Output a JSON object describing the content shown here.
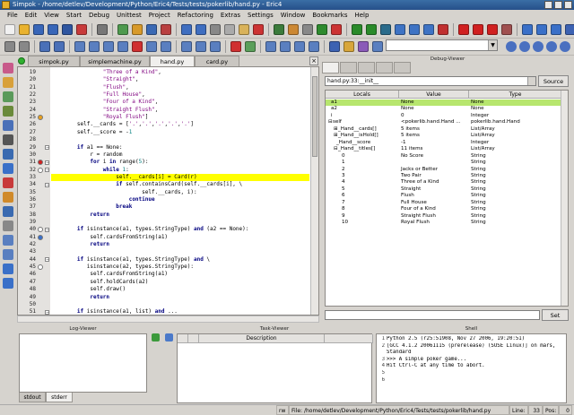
{
  "window": {
    "title": "Simpok - /home/detlev/Development/Python/Eric4/Tests/tests/pokerlib/hand.py - Eric4"
  },
  "menubar": [
    "File",
    "Edit",
    "View",
    "Start",
    "Debug",
    "Unittest",
    "Project",
    "Refactoring",
    "Extras",
    "Settings",
    "Window",
    "Bookmarks",
    "Help"
  ],
  "colors": {
    "current_line": "#ffff00",
    "selected_var": "#b7e66e",
    "keyword": "#00007f",
    "string": "#7f007f",
    "number": "#007f7f",
    "title_bar": "#3a6ea5"
  },
  "editor": {
    "tabs": [
      "simpok.py",
      "simplemachine.py",
      "hand.py",
      "card.py"
    ],
    "active_tab": 2,
    "lines": [
      {
        "n": "19",
        "code": "                \"Three of a Kind\","
      },
      {
        "n": "20",
        "code": "                \"Straight\","
      },
      {
        "n": "21",
        "code": "                \"Flush\","
      },
      {
        "n": "22",
        "code": "                \"Full House\","
      },
      {
        "n": "23",
        "code": "                \"Four of a Kind\","
      },
      {
        "n": "24",
        "code": "                \"Straight Flush\","
      },
      {
        "n": "25",
        "code": "                \"Royal Flush\"]"
      },
      {
        "n": "26",
        "code": "        self.__cards = ['.','.','.','.','.']"
      },
      {
        "n": "27",
        "code": "        self.__score = -1"
      },
      {
        "n": "28",
        "code": ""
      },
      {
        "n": "29",
        "code": "        if a1 == None:"
      },
      {
        "n": "30",
        "code": "            r = random"
      },
      {
        "n": "31",
        "code": "            for i in range(5):"
      },
      {
        "n": "32",
        "code": "                while 1:"
      },
      {
        "n": "33",
        "code": "                    self.__cards[i] = Card(r)"
      },
      {
        "n": "34",
        "code": "                    if self.containsCard(self.__cards[i], \\"
      },
      {
        "n": "35",
        "code": "                            self.__cards, i):"
      },
      {
        "n": "36",
        "code": "                        continue"
      },
      {
        "n": "37",
        "code": "                    break"
      },
      {
        "n": "38",
        "code": "            return"
      },
      {
        "n": "39",
        "code": ""
      },
      {
        "n": "40",
        "code": "        if isinstance(a1, types.StringType) and (a2 == None):"
      },
      {
        "n": "41",
        "code": "            self.cardsFromString(a1)"
      },
      {
        "n": "42",
        "code": "            return"
      },
      {
        "n": "43",
        "code": ""
      },
      {
        "n": "44",
        "code": "        if isinstance(a1, types.StringType) and \\"
      },
      {
        "n": "45",
        "code": "           isinstance(a2, types.StringType):"
      },
      {
        "n": "46",
        "code": "            self.cardsFromString(a1)"
      },
      {
        "n": "47",
        "code": "            self.holdCards(a2)"
      },
      {
        "n": "48",
        "code": "            self.draw()"
      },
      {
        "n": "49",
        "code": "            return"
      },
      {
        "n": "50",
        "code": ""
      },
      {
        "n": "51",
        "code": "        if isinstance(a1, list) and ..."
      }
    ]
  },
  "debug_viewer": {
    "title": "Debug-Viewer",
    "frame": "hand.py:33:__init__",
    "source_button": "Source",
    "columns": [
      "Locals",
      "Value",
      "Type"
    ],
    "rows": [
      {
        "name": "a1",
        "value": "None",
        "type": "None",
        "indent": 0,
        "selected": true
      },
      {
        "name": "a2",
        "value": "None",
        "type": "None",
        "indent": 0
      },
      {
        "name": "i",
        "value": "0",
        "type": "Integer",
        "indent": 0
      },
      {
        "name": "self",
        "value": "<pokerlib.hand.Hand ...",
        "type": "pokerlib.hand.Hand",
        "indent": 0,
        "expander": "-"
      },
      {
        "name": "_Hand__cards[]",
        "value": "5 items",
        "type": "List/Array",
        "indent": 1,
        "expander": "+"
      },
      {
        "name": "_Hand__isHold[]",
        "value": "5 items",
        "type": "List/Array",
        "indent": 1,
        "expander": "+"
      },
      {
        "name": "_Hand__score",
        "value": "-1",
        "type": "Integer",
        "indent": 1
      },
      {
        "name": "_Hand__titles[]",
        "value": "11 items",
        "type": "List/Array",
        "indent": 1,
        "expander": "-"
      },
      {
        "name": "0",
        "value": "No Score",
        "type": "String",
        "indent": 2
      },
      {
        "name": "1",
        "value": "",
        "type": "String",
        "indent": 2
      },
      {
        "name": "2",
        "value": "Jacks or Better",
        "type": "String",
        "indent": 2
      },
      {
        "name": "3",
        "value": "Two Pair",
        "type": "String",
        "indent": 2
      },
      {
        "name": "4",
        "value": "Three of a Kind",
        "type": "String",
        "indent": 2
      },
      {
        "name": "5",
        "value": "Straight",
        "type": "String",
        "indent": 2
      },
      {
        "name": "6",
        "value": "Flush",
        "type": "String",
        "indent": 2
      },
      {
        "name": "7",
        "value": "Full House",
        "type": "String",
        "indent": 2
      },
      {
        "name": "8",
        "value": "Four of a Kind",
        "type": "String",
        "indent": 2
      },
      {
        "name": "9",
        "value": "Straight Flush",
        "type": "String",
        "indent": 2
      },
      {
        "name": "10",
        "value": "Royal Flush",
        "type": "String",
        "indent": 2
      }
    ],
    "set_button": "Set"
  },
  "log_viewer": {
    "title": "Log-Viewer",
    "tabs": [
      "stdout",
      "stderr"
    ],
    "active_tab": 1
  },
  "task_viewer": {
    "title": "Task-Viewer",
    "columns": [
      "",
      "",
      "Description",
      ""
    ]
  },
  "shell": {
    "title": "Shell",
    "lines": [
      {
        "n": "1",
        "text": "Python 2.5 (r25:51908, Nov 27 2006, 19:20:51)"
      },
      {
        "n": "2",
        "text": "[GCC 4.1.2 20061115 (prerelease) (SUSE Linux)] on mars,"
      },
      {
        "n": "",
        "text": "Standard"
      },
      {
        "n": "3",
        "text": ">>> A simple poker game..."
      },
      {
        "n": "4",
        "text": "Hit Ctrl-C at any time to abort."
      },
      {
        "n": "5",
        "text": ""
      },
      {
        "n": "6",
        "text": ""
      }
    ]
  },
  "statusbar": {
    "mode": "rw",
    "file": "File: /home/detlev/Development/Python/Eric4/Tests/tests/pokerlib/hand.py",
    "line_label": "Line:",
    "line": "33",
    "pos_label": "Pos:",
    "pos": "0"
  }
}
